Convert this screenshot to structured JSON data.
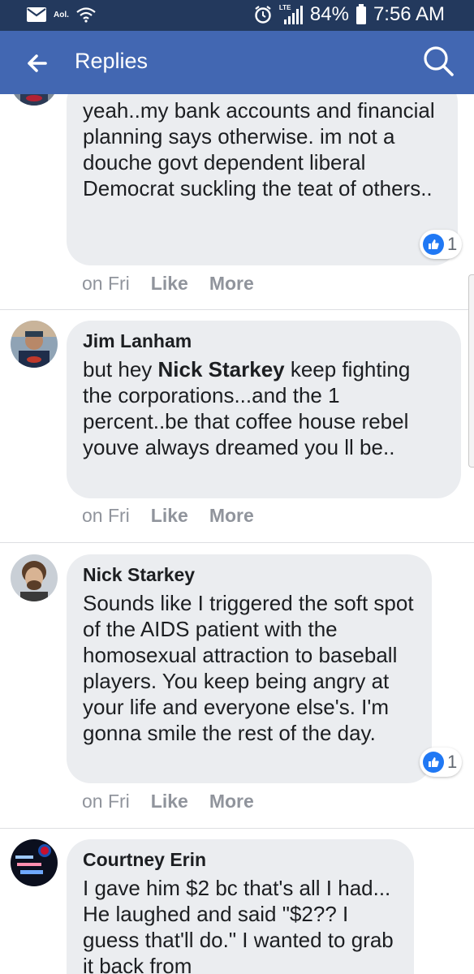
{
  "status_bar": {
    "carrier": "Aol.",
    "network": "LTE",
    "battery": "84%",
    "time": "7:56 AM",
    "icons": [
      "mail-icon",
      "wifi-icon",
      "alarm-icon",
      "signal-icon",
      "battery-icon"
    ]
  },
  "app_bar": {
    "title": "Replies",
    "back_icon": "back-arrow-icon",
    "search_icon": "search-icon"
  },
  "comments": [
    {
      "author": "",
      "text": "yeah..my bank accounts and financial planning says otherwise. im not a douche govt dependent liberal Democrat suckling the teat of others..",
      "time": "on Fri",
      "like_label": "Like",
      "more_label": "More",
      "reactions": "1"
    },
    {
      "author": "Jim Lanham",
      "text_before": "but hey ",
      "mention": "Nick Starkey",
      "text_after": " keep fighting the corporations...and the 1 percent..be that coffee house rebel youve always dreamed you ll be..",
      "time": "on Fri",
      "like_label": "Like",
      "more_label": "More"
    },
    {
      "author": "Nick Starkey",
      "text": "Sounds like I triggered the soft spot of the AIDS patient with the homosexual attraction to baseball players. You keep being angry at your life and everyone else's. I'm gonna smile the rest of the day.",
      "time": "on Fri",
      "like_label": "Like",
      "more_label": "More",
      "reactions": "1"
    },
    {
      "author": "Courtney Erin",
      "text": "I gave him $2 bc that's all I had... He laughed and said \"$2?? I guess that'll do.\" I wanted to grab it back from"
    }
  ],
  "colors": {
    "status_bar": "#23395d",
    "app_bar": "#4267b2",
    "bubble": "#ebedf0",
    "meta_text": "#90949c",
    "like_blue": "#2078f4"
  }
}
